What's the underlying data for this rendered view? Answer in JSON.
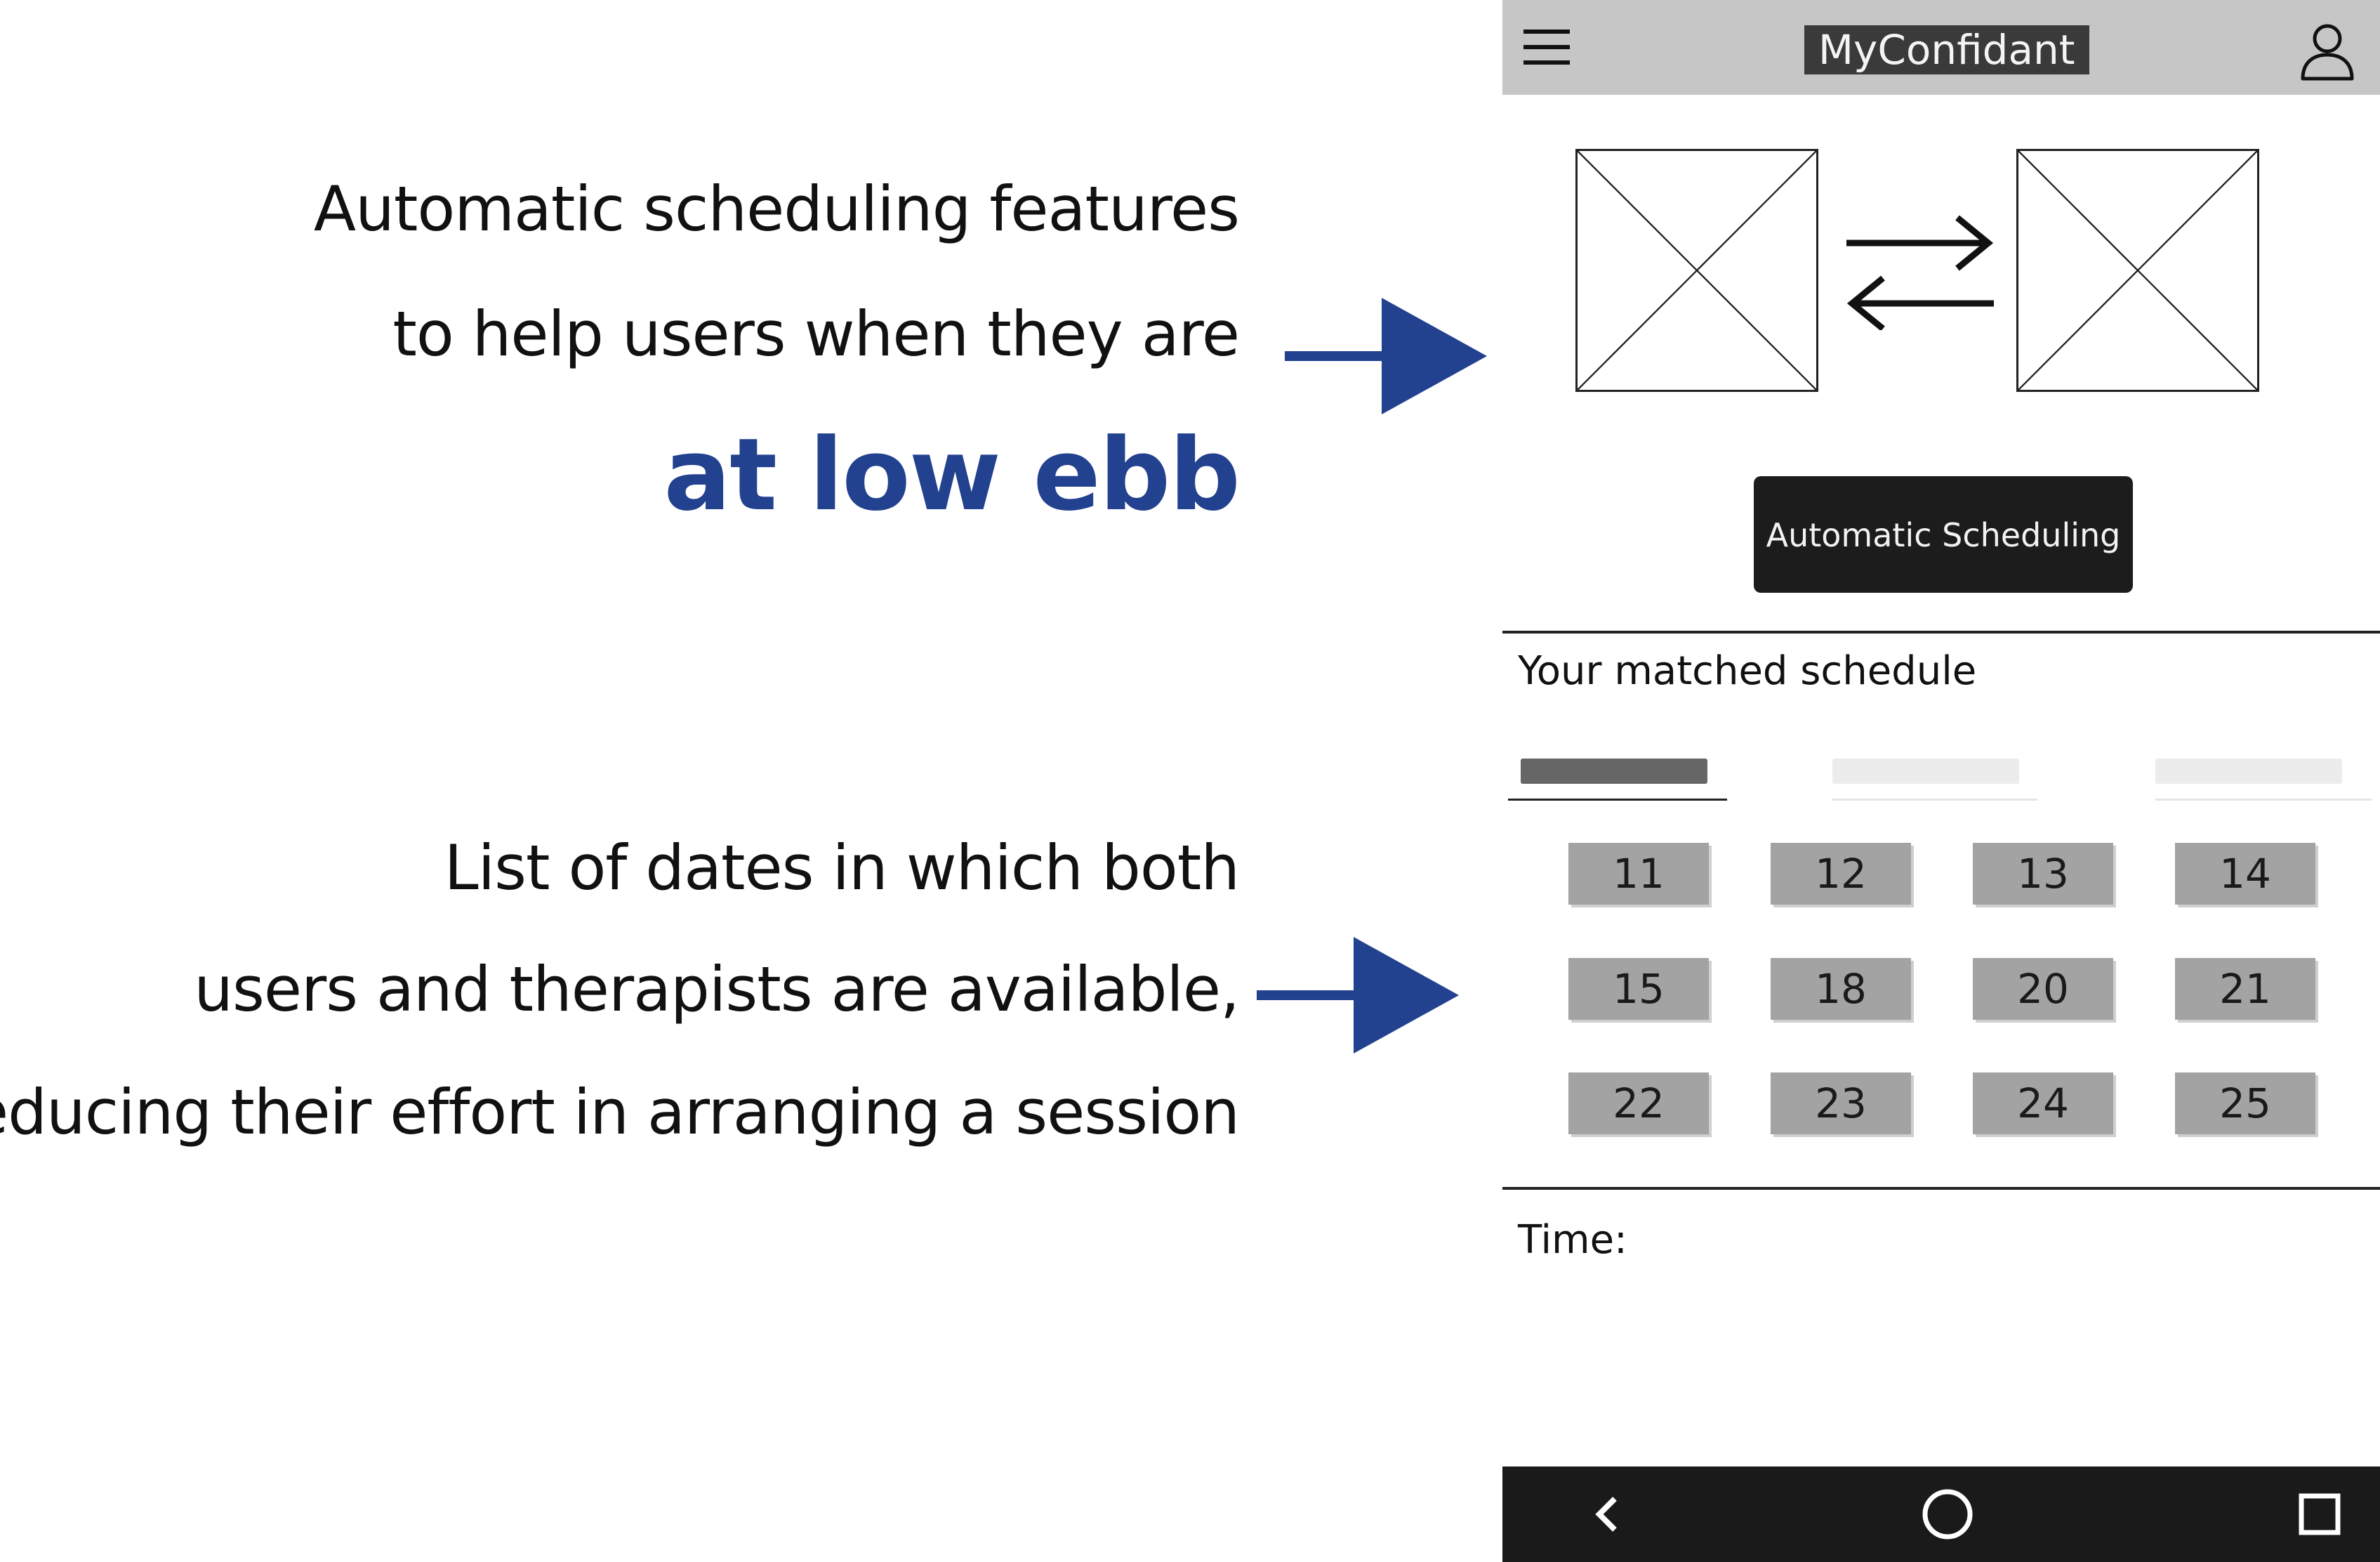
{
  "annotations": [
    {
      "lines": [
        "Automatic scheduling features",
        "to help users when they are"
      ],
      "emphasis": "at low ebb"
    },
    {
      "lines": [
        "List of dates in which both",
        "users and therapists are available,",
        "reducing their effort in arranging a session"
      ]
    }
  ],
  "colors": {
    "accent": "#22418f",
    "app_bar": "#c6c6c6",
    "title_bg": "#3a3a3a",
    "button_bg": "#1c1c1c",
    "date_cell": "#a3a3a3",
    "nav_bar": "#1a1a1a"
  },
  "phone": {
    "app_bar": {
      "menu_icon": "hamburger-menu-icon",
      "title": "MyConfidant",
      "profile_icon": "user-profile-icon"
    },
    "matching": {
      "left_image": "image-placeholder",
      "swap_icon": "swap-arrows-icon",
      "right_image": "image-placeholder"
    },
    "auto_button_label": "Automatic Scheduling",
    "schedule": {
      "title": "Your matched schedule",
      "tabs": [
        {
          "label": "",
          "selected": true
        },
        {
          "label": "",
          "selected": false
        },
        {
          "label": "",
          "selected": false
        }
      ],
      "dates": [
        "11",
        "12",
        "13",
        "14",
        "15",
        "18",
        "20",
        "21",
        "22",
        "23",
        "24",
        "25"
      ]
    },
    "time_label": "Time:",
    "nav": {
      "back_icon": "back-icon",
      "home_icon": "home-icon",
      "recents_icon": "recents-icon"
    }
  }
}
